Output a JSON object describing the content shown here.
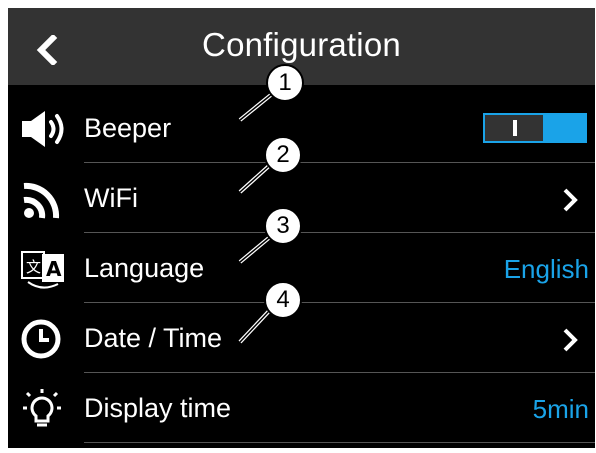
{
  "header": {
    "title": "Configuration",
    "back_icon": "chevron-left-icon"
  },
  "rows": [
    {
      "icon": "speaker-icon",
      "label": "Beeper",
      "control": "toggle",
      "state": "on"
    },
    {
      "icon": "wifi-icon",
      "label": "WiFi",
      "control": "chevron"
    },
    {
      "icon": "language-icon",
      "label": "Language",
      "control": "value",
      "value": "English"
    },
    {
      "icon": "clock-icon",
      "label": "Date / Time",
      "control": "chevron"
    },
    {
      "icon": "lightbulb-icon",
      "label": "Display time",
      "control": "value",
      "value": "5min"
    }
  ],
  "callouts": [
    "1",
    "2",
    "3",
    "4"
  ],
  "colors": {
    "background": "#000000",
    "header": "#333333",
    "accent": "#1aa3e8",
    "text": "#ffffff"
  }
}
